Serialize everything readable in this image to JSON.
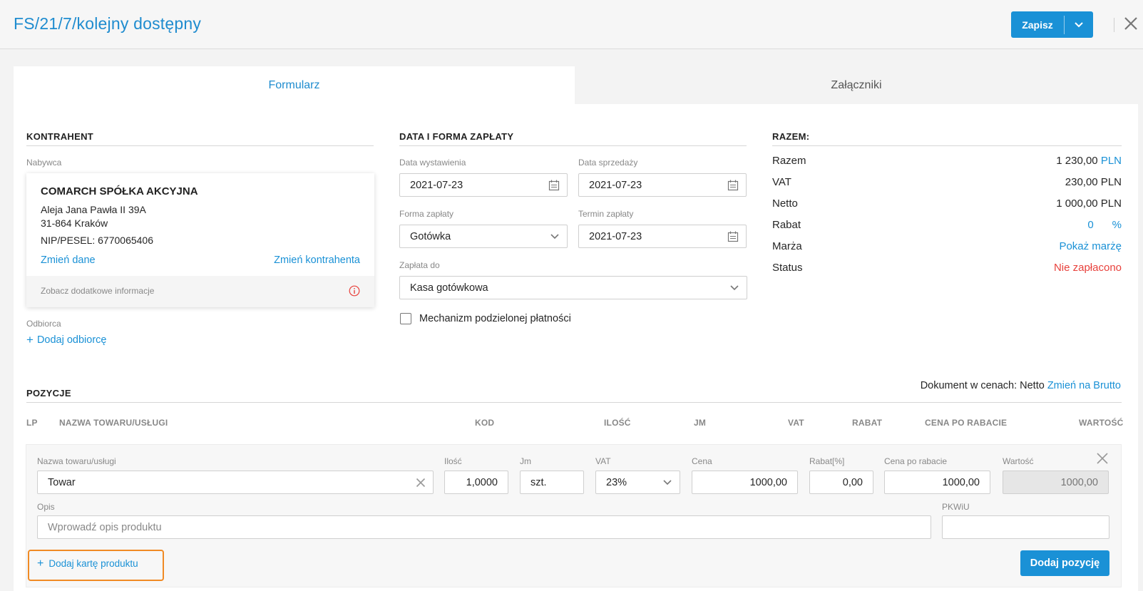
{
  "header": {
    "title": "FS/21/7/kolejny dostępny",
    "save_label": "Zapisz"
  },
  "tabs": {
    "form": "Formularz",
    "attachments": "Załączniki"
  },
  "contractor": {
    "section_title": "KONTRAHENT",
    "buyer_label": "Nabywca",
    "name": "COMARCH SPÓŁKA AKCYJNA",
    "address_line1": "Aleja Jana Pawła II 39A",
    "address_line2": "31-864 Kraków",
    "nip": "NIP/PESEL: 6770065406",
    "change_data": "Zmień dane",
    "change_contractor": "Zmień kontrahenta",
    "more_info": "Zobacz dodatkowe informacje",
    "recipient_label": "Odbiorca",
    "add_recipient": "Dodaj odbiorcę"
  },
  "payment": {
    "section_title": "DATA I FORMA ZAPŁATY",
    "issue_date_label": "Data wystawienia",
    "issue_date": "2021-07-23",
    "sale_date_label": "Data sprzedaży",
    "sale_date": "2021-07-23",
    "payment_form_label": "Forma zapłaty",
    "payment_form": "Gotówka",
    "due_date_label": "Termin zapłaty",
    "due_date": "2021-07-23",
    "pay_to_label": "Zapłata do",
    "pay_to": "Kasa gotówkowa",
    "split_payment": "Mechanizm podzielonej płatności",
    "split_payment_checked": false
  },
  "summary": {
    "section_title": "RAZEM:",
    "total_label": "Razem",
    "total_value": "1 230,00",
    "total_currency": "PLN",
    "vat_label": "VAT",
    "vat_value": "230,00 PLN",
    "net_label": "Netto",
    "net_value": "1 000,00 PLN",
    "discount_label": "Rabat",
    "discount_value": "0",
    "discount_unit": "%",
    "margin_label": "Marża",
    "margin_link": "Pokaż marżę",
    "status_label": "Status",
    "status_value": "Nie zapłacono",
    "status_color": "#e8413c",
    "accent_color": "#1a91d6"
  },
  "positions": {
    "section_title": "POZYCJE",
    "prices_text": "Dokument w cenach: Netto",
    "switch_link": "Zmień na Brutto",
    "columns": [
      "LP",
      "NAZWA TOWARU/USŁUGI",
      "KOD",
      "ILOŚĆ",
      "JM",
      "VAT",
      "RABAT",
      "CENA PO RABACIE",
      "WARTOŚĆ"
    ],
    "editor": {
      "name_label": "Nazwa towaru/usługi",
      "name_value": "Towar",
      "qty_label": "Ilość",
      "qty_value": "1,0000",
      "unit_label": "Jm",
      "unit_value": "szt.",
      "vat_label": "VAT",
      "vat_value": "23%",
      "price_label": "Cena",
      "price_value": "1000,00",
      "discount_label": "Rabat[%]",
      "discount_value": "0,00",
      "price_after_label": "Cena po rabacie",
      "price_after_value": "1000,00",
      "value_label": "Wartość",
      "value_value": "1000,00",
      "desc_label": "Opis",
      "desc_placeholder": "Wprowadź opis produktu",
      "pkwiu_label": "PKWiU",
      "pkwiu_value": "",
      "add_product_card": "Dodaj kartę produktu",
      "add_position": "Dodaj pozycję"
    }
  }
}
